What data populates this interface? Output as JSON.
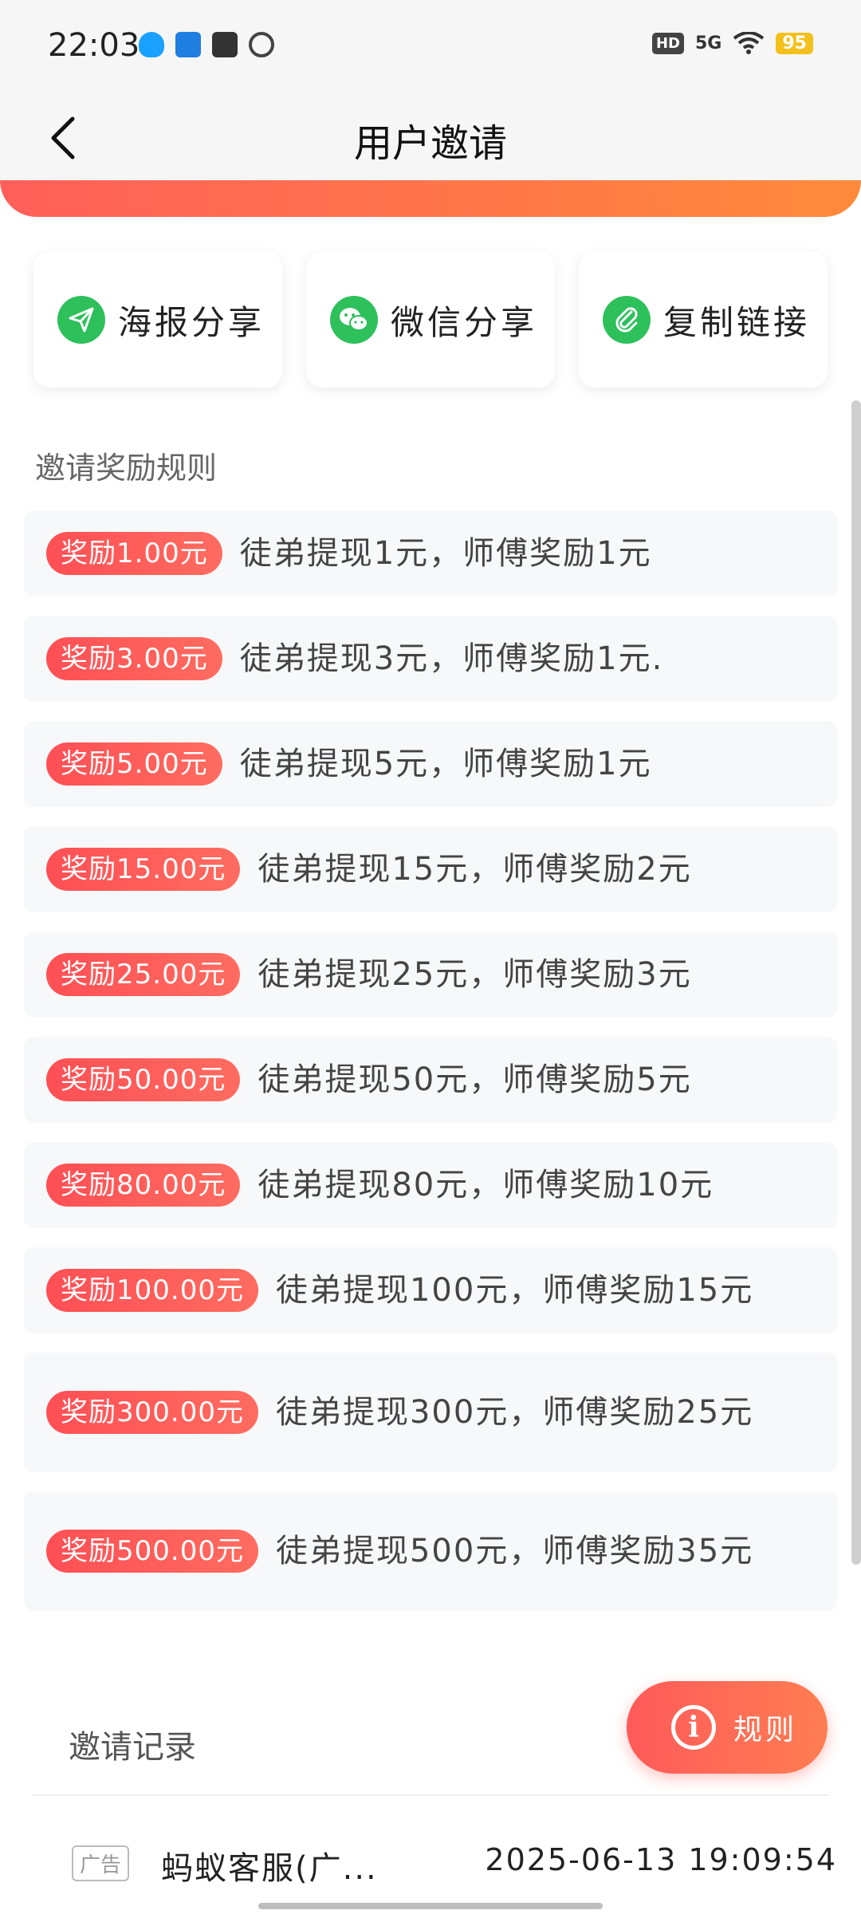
{
  "status_bar": {
    "time": "22:03",
    "network": "5G",
    "hd": "HD",
    "battery": "95"
  },
  "header": {
    "title": "用户邀请"
  },
  "share": [
    {
      "label": "海报分享",
      "icon": "send-icon"
    },
    {
      "label": "微信分享",
      "icon": "wechat-icon"
    },
    {
      "label": "复制链接",
      "icon": "link-icon"
    }
  ],
  "rules": {
    "title": "邀请奖励规则",
    "items": [
      {
        "badge": "奖励1.00元",
        "text": "徒弟提现1元，师傅奖励1元"
      },
      {
        "badge": "奖励3.00元",
        "text": "徒弟提现3元，师傅奖励1元."
      },
      {
        "badge": "奖励5.00元",
        "text": "徒弟提现5元，师傅奖励1元"
      },
      {
        "badge": "奖励15.00元",
        "text": "徒弟提现15元，师傅奖励2元"
      },
      {
        "badge": "奖励25.00元",
        "text": "徒弟提现25元，师傅奖励3元"
      },
      {
        "badge": "奖励50.00元",
        "text": "徒弟提现50元，师傅奖励5元"
      },
      {
        "badge": "奖励80.00元",
        "text": "徒弟提现80元，师傅奖励10元"
      },
      {
        "badge": "奖励100.00元",
        "text": "徒弟提现100元，师傅奖励15元"
      },
      {
        "badge": "奖励300.00元",
        "text": "徒弟提现300元，师傅奖励25元"
      },
      {
        "badge": "奖励500.00元",
        "text": "徒弟提现500元，师傅奖励35元"
      }
    ]
  },
  "records": {
    "title": "邀请记录",
    "items": [
      {
        "ad_label": "广告",
        "name": "蚂蚁客服(广...",
        "time": "2025-06-13 19:09:54"
      }
    ]
  },
  "fab": {
    "label": "规则"
  },
  "colors": {
    "accent_start": "#ff4f55",
    "accent_end": "#ff8a3c",
    "share_green": "#2dc05b"
  }
}
